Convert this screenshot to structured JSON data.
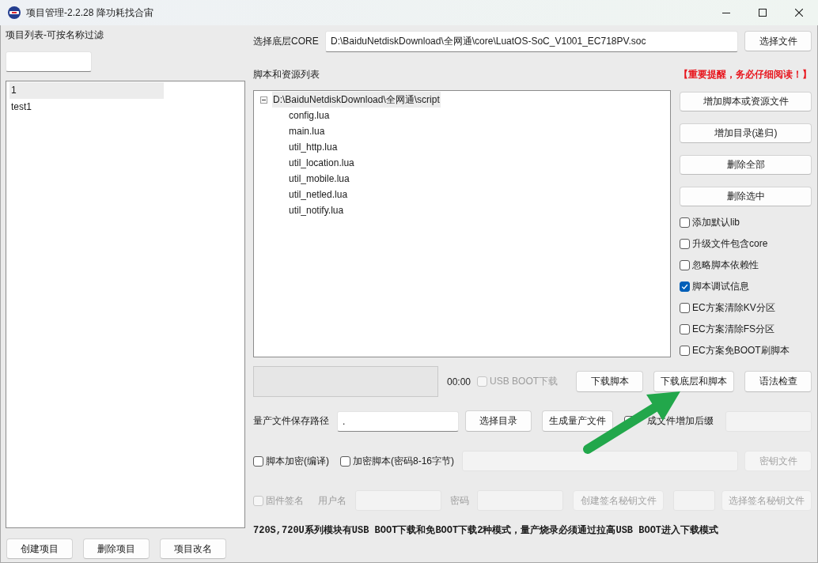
{
  "window": {
    "title": "项目管理-2.2.28 降功耗找合宙"
  },
  "projects": {
    "label": "项目列表-可按名称过滤",
    "items": [
      {
        "name": "1",
        "selected": true
      },
      {
        "name": "test1",
        "selected": false
      }
    ],
    "buttons": [
      {
        "label": "创建项目"
      },
      {
        "label": "删除项目"
      },
      {
        "label": "项目改名"
      }
    ]
  },
  "core": {
    "label": "选择底层CORE",
    "path": "D:\\BaiduNetdiskDownload\\全网通\\core\\LuatOS-SoC_V1001_EC718PV.soc",
    "button": {
      "label": "选择文件"
    }
  },
  "scripts": {
    "label": "脚本和资源列表",
    "warning": "【重要提醒，务必仔细阅读！】",
    "tree": [
      {
        "label": "D:\\BaiduNetdiskDownload\\全网通\\script",
        "expanded": true,
        "selected": true,
        "children": [
          {
            "label": "config.lua",
            "selected": false
          },
          {
            "label": "main.lua",
            "selected": false
          },
          {
            "label": "util_http.lua",
            "selected": false
          },
          {
            "label": "util_location.lua",
            "selected": false
          },
          {
            "label": "util_mobile.lua",
            "selected": false
          },
          {
            "label": "util_netled.lua",
            "selected": false
          },
          {
            "label": "util_notify.lua",
            "selected": false
          }
        ]
      }
    ]
  },
  "actions": [
    {
      "label": "增加脚本或资源文件"
    },
    {
      "label": "增加目录(递归)"
    },
    {
      "label": "删除全部"
    },
    {
      "label": "删除选中"
    }
  ],
  "options": [
    {
      "label": "添加默认lib",
      "checked": false
    },
    {
      "label": "升级文件包含core",
      "checked": false
    },
    {
      "label": "忽略脚本依赖性",
      "checked": false
    },
    {
      "label": "脚本调试信息",
      "checked": true
    },
    {
      "label": "EC方案清除KV分区",
      "checked": false
    },
    {
      "label": "EC方案清除FS分区",
      "checked": false
    },
    {
      "label": "EC方案免BOOT刷脚本",
      "checked": false
    }
  ],
  "download": {
    "progress": {
      "level": 0
    },
    "time": "00:00",
    "usb_boot": {
      "label": "USB BOOT下载",
      "checked": false,
      "disabled": true
    },
    "buttons": [
      {
        "label": "下载脚本"
      },
      {
        "label": "下载底层和脚本"
      },
      {
        "label": "语法检查"
      }
    ]
  },
  "mass_production": {
    "label": "量产文件保存路径",
    "path": ".",
    "buttons": [
      {
        "label": "选择目录"
      },
      {
        "label": "生成量产文件"
      }
    ],
    "suffix": {
      "label": "成文件增加后缀",
      "checked": false
    },
    "suffix_field": {
      "disabled": true
    }
  },
  "encryption": {
    "compile": {
      "label": "脚本加密(编译)",
      "checked": false
    },
    "password": {
      "label": "加密脚本(密码8-16字节)",
      "checked": false
    },
    "password_field": {
      "disabled": true
    },
    "key_button": {
      "label": "密钥文件",
      "disabled": true
    }
  },
  "signing": {
    "enable": {
      "label": "固件签名",
      "checked": false,
      "disabled": true
    },
    "username_label": {
      "text": "用户名",
      "disabled": true
    },
    "username_field": {
      "disabled": true
    },
    "password_label": {
      "text": "密码",
      "disabled": true
    },
    "password_field": {
      "disabled": true
    },
    "create_button": {
      "label": "创建签名秘钥文件",
      "disabled": true
    },
    "extra_field": {
      "disabled": true
    },
    "select_button": {
      "label": "选择签名秘钥文件",
      "disabled": true
    }
  },
  "note": "720S,720U系列模块有USB BOOT下载和免BOOT下载2种模式，量产烧录必须通过拉高USB BOOT进入下载模式"
}
